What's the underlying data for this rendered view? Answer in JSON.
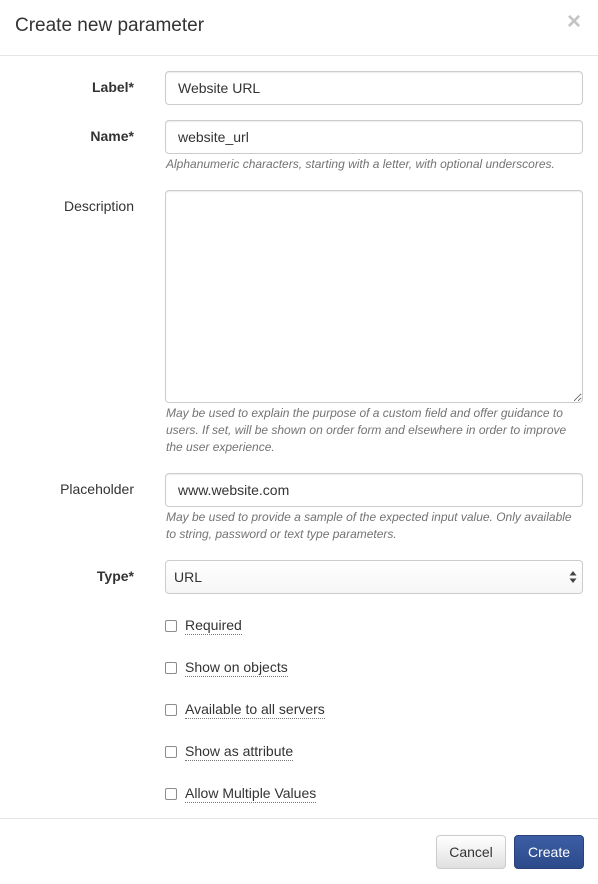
{
  "dialog": {
    "title": "Create new parameter",
    "close_glyph": "×"
  },
  "fields": {
    "label": {
      "label": "Label*",
      "value": "Website URL"
    },
    "name": {
      "label": "Name*",
      "value": "website_url",
      "help": "Alphanumeric characters, starting with a letter, with optional underscores."
    },
    "description": {
      "label": "Description",
      "value": "",
      "help": "May be used to explain the purpose of a custom field and offer guidance to users. If set, will be shown on order form and elsewhere in order to improve the user experience."
    },
    "placeholder": {
      "label": "Placeholder",
      "value": "www.website.com",
      "help": "May be used to provide a sample of the expected input value. Only available to string, password or text type parameters."
    },
    "type": {
      "label": "Type*",
      "selected": "URL"
    }
  },
  "checkboxes": [
    {
      "label": "Required",
      "checked": false
    },
    {
      "label": "Show on objects",
      "checked": false
    },
    {
      "label": "Available to all servers",
      "checked": false
    },
    {
      "label": "Show as attribute",
      "checked": false
    },
    {
      "label": "Allow Multiple Values",
      "checked": false
    }
  ],
  "footer": {
    "cancel_label": "Cancel",
    "create_label": "Create"
  },
  "colors": {
    "primary": "#2f4f94",
    "help_text": "#737373",
    "border": "#cccccc"
  }
}
